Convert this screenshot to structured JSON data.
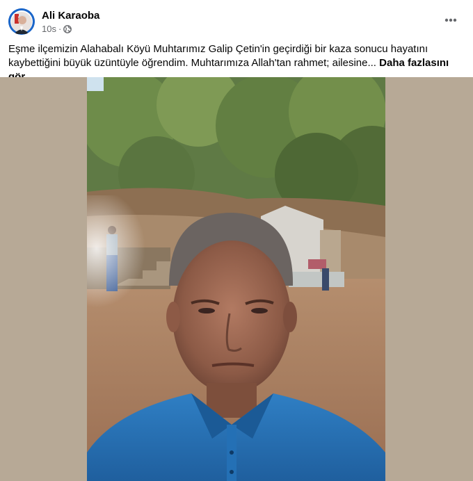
{
  "post": {
    "author": "Ali Karaoba",
    "time": "10s",
    "separator": "·",
    "privacy_icon": "globe-icon",
    "more_icon": "more-options-icon",
    "text": "Eşme ilçemizin Alahabalı Köyü Muhtarımız Galip Çetin'in geçirdiği bir kaza sonucu hayatını kaybettiğini büyük üzüntüyle öğrendim. Muhtarımıza Allah'tan rahmet; ailesine...",
    "see_more": "Daha fazlasını gör"
  },
  "colors": {
    "media_background": "#b7a996",
    "avatar_ring": "#1b66c9"
  }
}
